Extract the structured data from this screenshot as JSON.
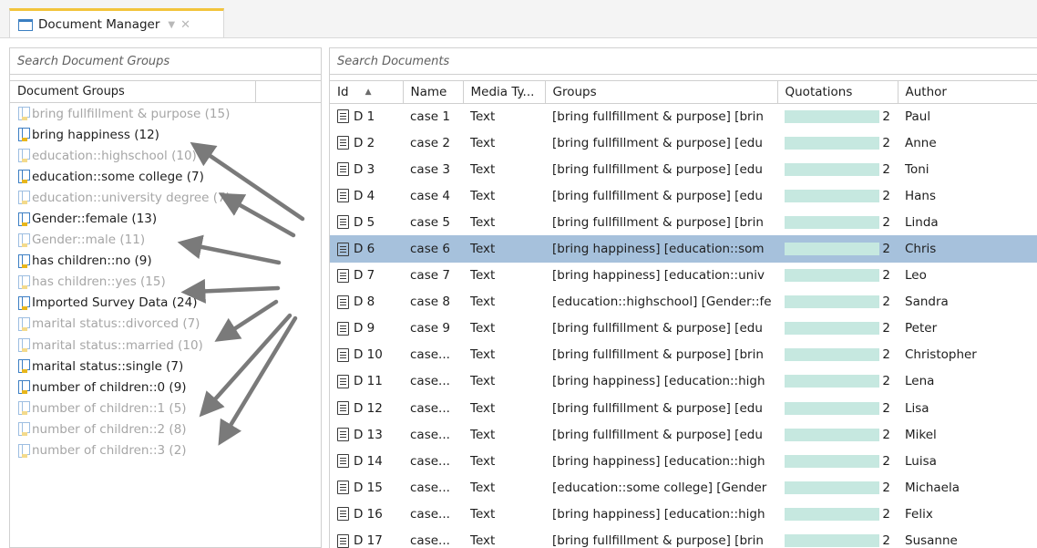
{
  "tab": {
    "title": "Document Manager",
    "dropdown_icon": "chevron-down-icon",
    "close_icon": "close-icon"
  },
  "left": {
    "search_placeholder": "Search Document Groups",
    "column_header": "Document Groups",
    "groups": [
      {
        "label": "bring fullfillment & purpose (15)",
        "dim": true
      },
      {
        "label": "bring happiness (12)",
        "dim": false
      },
      {
        "label": "education::highschool (10)",
        "dim": true
      },
      {
        "label": "education::some college (7)",
        "dim": false
      },
      {
        "label": "education::university degree (7)",
        "dim": true
      },
      {
        "label": "Gender::female (13)",
        "dim": false
      },
      {
        "label": "Gender::male (11)",
        "dim": true
      },
      {
        "label": "has children::no (9)",
        "dim": false
      },
      {
        "label": "has children::yes (15)",
        "dim": true
      },
      {
        "label": "Imported Survey Data (24)",
        "dim": false
      },
      {
        "label": "marital status::divorced (7)",
        "dim": true
      },
      {
        "label": "marital status::married (10)",
        "dim": true
      },
      {
        "label": "marital status::single (7)",
        "dim": false
      },
      {
        "label": "number of children::0 (9)",
        "dim": false
      },
      {
        "label": "number of children::1 (5)",
        "dim": true
      },
      {
        "label": "number of children::2 (8)",
        "dim": true
      },
      {
        "label": "number of children::3 (2)",
        "dim": true
      }
    ]
  },
  "right": {
    "search_placeholder": "Search Documents",
    "columns": [
      "Id",
      "Name",
      "Media Ty...",
      "Groups",
      "Quotations",
      "Author"
    ],
    "rows": [
      {
        "id": "D 1",
        "name": "case 1",
        "media": "Text",
        "groups": "[bring fullfillment & purpose] [brin",
        "quotations": "2",
        "author": "Paul"
      },
      {
        "id": "D 2",
        "name": "case 2",
        "media": "Text",
        "groups": "[bring fullfillment & purpose] [edu",
        "quotations": "2",
        "author": "Anne"
      },
      {
        "id": "D 3",
        "name": "case 3",
        "media": "Text",
        "groups": "[bring fullfillment & purpose] [edu",
        "quotations": "2",
        "author": "Toni"
      },
      {
        "id": "D 4",
        "name": "case 4",
        "media": "Text",
        "groups": "[bring fullfillment & purpose] [edu",
        "quotations": "2",
        "author": "Hans"
      },
      {
        "id": "D 5",
        "name": "case 5",
        "media": "Text",
        "groups": "[bring fullfillment & purpose] [brin",
        "quotations": "2",
        "author": "Linda"
      },
      {
        "id": "D 6",
        "name": "case 6",
        "media": "Text",
        "groups": "[bring happiness] [education::som",
        "quotations": "2",
        "author": "Chris",
        "selected": true
      },
      {
        "id": "D 7",
        "name": "case 7",
        "media": "Text",
        "groups": "[bring happiness] [education::univ",
        "quotations": "2",
        "author": "Leo"
      },
      {
        "id": "D 8",
        "name": "case 8",
        "media": "Text",
        "groups": "[education::highschool] [Gender::fe",
        "quotations": "2",
        "author": "Sandra"
      },
      {
        "id": "D 9",
        "name": "case 9",
        "media": "Text",
        "groups": "[bring fullfillment & purpose] [edu",
        "quotations": "2",
        "author": "Peter"
      },
      {
        "id": "D 10",
        "name": "case...",
        "media": "Text",
        "groups": "[bring fullfillment & purpose] [brin",
        "quotations": "2",
        "author": "Christopher"
      },
      {
        "id": "D 11",
        "name": "case...",
        "media": "Text",
        "groups": "[bring happiness] [education::high",
        "quotations": "2",
        "author": "Lena"
      },
      {
        "id": "D 12",
        "name": "case...",
        "media": "Text",
        "groups": "[bring fullfillment & purpose] [edu",
        "quotations": "2",
        "author": "Lisa"
      },
      {
        "id": "D 13",
        "name": "case...",
        "media": "Text",
        "groups": "[bring fullfillment & purpose] [edu",
        "quotations": "2",
        "author": "Mikel"
      },
      {
        "id": "D 14",
        "name": "case...",
        "media": "Text",
        "groups": "[bring happiness] [education::high",
        "quotations": "2",
        "author": "Luisa"
      },
      {
        "id": "D 15",
        "name": "case...",
        "media": "Text",
        "groups": "[education::some college] [Gender",
        "quotations": "2",
        "author": "Michaela"
      },
      {
        "id": "D 16",
        "name": "case...",
        "media": "Text",
        "groups": "[bring happiness] [education::high",
        "quotations": "2",
        "author": "Felix"
      },
      {
        "id": "D 17",
        "name": "case...",
        "media": "Text",
        "groups": "[bring fullfillment & purpose] [brin",
        "quotations": "2",
        "author": "Susanne"
      }
    ]
  },
  "colors": {
    "accent": "#f2c43c",
    "selection": "#a6c1dc",
    "quotation_bar": "#c6e8e0",
    "arrow": "#7a7a7a"
  }
}
